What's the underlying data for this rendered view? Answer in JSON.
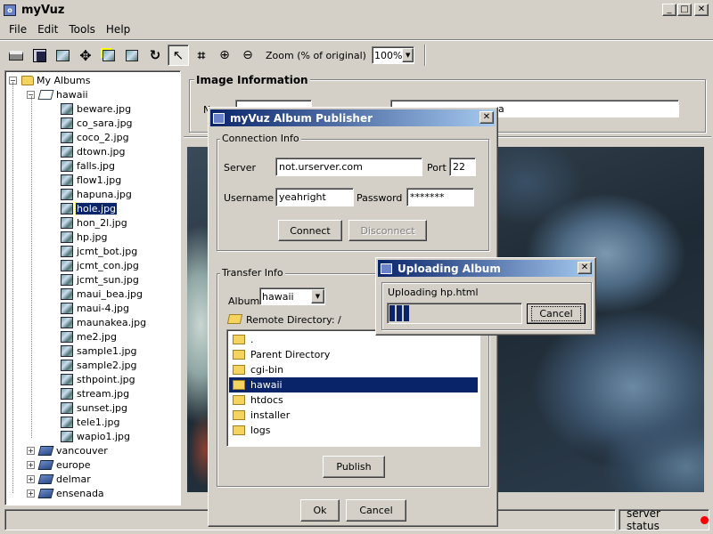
{
  "window": {
    "title": "myVuz"
  },
  "menu": [
    "File",
    "Edit",
    "Tools",
    "Help"
  ],
  "toolbar": {
    "zoom_label": "Zoom (% of original)",
    "zoom_value": "100%"
  },
  "tree": {
    "root": "My Albums",
    "open_album": "hawaii",
    "files": [
      "beware.jpg",
      "co_sara.jpg",
      "coco_2.jpg",
      "dtown.jpg",
      "falls.jpg",
      "flow1.jpg",
      "hapuna.jpg",
      "hole.jpg",
      "hon_2l.jpg",
      "hp.jpg",
      "jcmt_bot.jpg",
      "jcmt_con.jpg",
      "jcmt_sun.jpg",
      "maui_bea.jpg",
      "maui-4.jpg",
      "maunakea.jpg",
      "me2.jpg",
      "sample1.jpg",
      "sample2.jpg",
      "sthpoint.jpg",
      "stream.jpg",
      "sunset.jpg",
      "tele1.jpg",
      "wapio1.jpg"
    ],
    "selected": "hole.jpg",
    "albums": [
      "vancouver",
      "europe",
      "delmar",
      "ensenada"
    ]
  },
  "image_info": {
    "title": "Image Information",
    "label_partial": "N",
    "field_partial": "a"
  },
  "status": {
    "text": "server status",
    "indicator_color": "#ff0000"
  },
  "publisher": {
    "title": "myVuz Album Publisher",
    "connection": {
      "title": "Connection Info",
      "server_label": "Server",
      "server_value": "not.urserver.com",
      "port_label": "Port",
      "port_value": "22",
      "username_label": "Username",
      "username_value": "yeahright",
      "password_label": "Password",
      "password_value": "*******",
      "connect": "Connect",
      "disconnect": "Disconnect"
    },
    "transfer": {
      "title": "Transfer Info",
      "album_label": "Album",
      "album_value": "hawaii",
      "remote_label": "Remote Directory: /",
      "dirs": [
        ".",
        "Parent Directory",
        "cgi-bin",
        "hawaii",
        "htdocs",
        "installer",
        "logs"
      ],
      "selected_dir": "hawaii",
      "publish": "Publish"
    },
    "ok": "Ok",
    "cancel": "Cancel"
  },
  "upload": {
    "title": "Uploading Album",
    "message": "Uploading hp.html",
    "progress": 0.15,
    "cancel": "Cancel"
  }
}
